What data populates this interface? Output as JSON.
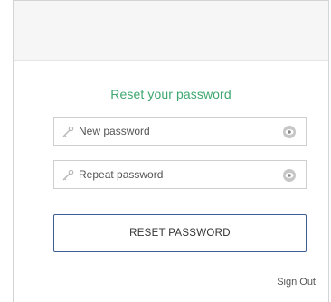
{
  "form": {
    "title": "Reset your password",
    "new_password_placeholder": "New password",
    "repeat_password_placeholder": "Repeat password",
    "reset_button_label": "RESET PASSWORD",
    "sign_out_label": "Sign Out"
  },
  "icons": {
    "field_prefix": "key-icon",
    "field_suffix": "eye-icon"
  },
  "colors": {
    "title": "#3ea76f",
    "button_border": "#3e5e96"
  }
}
